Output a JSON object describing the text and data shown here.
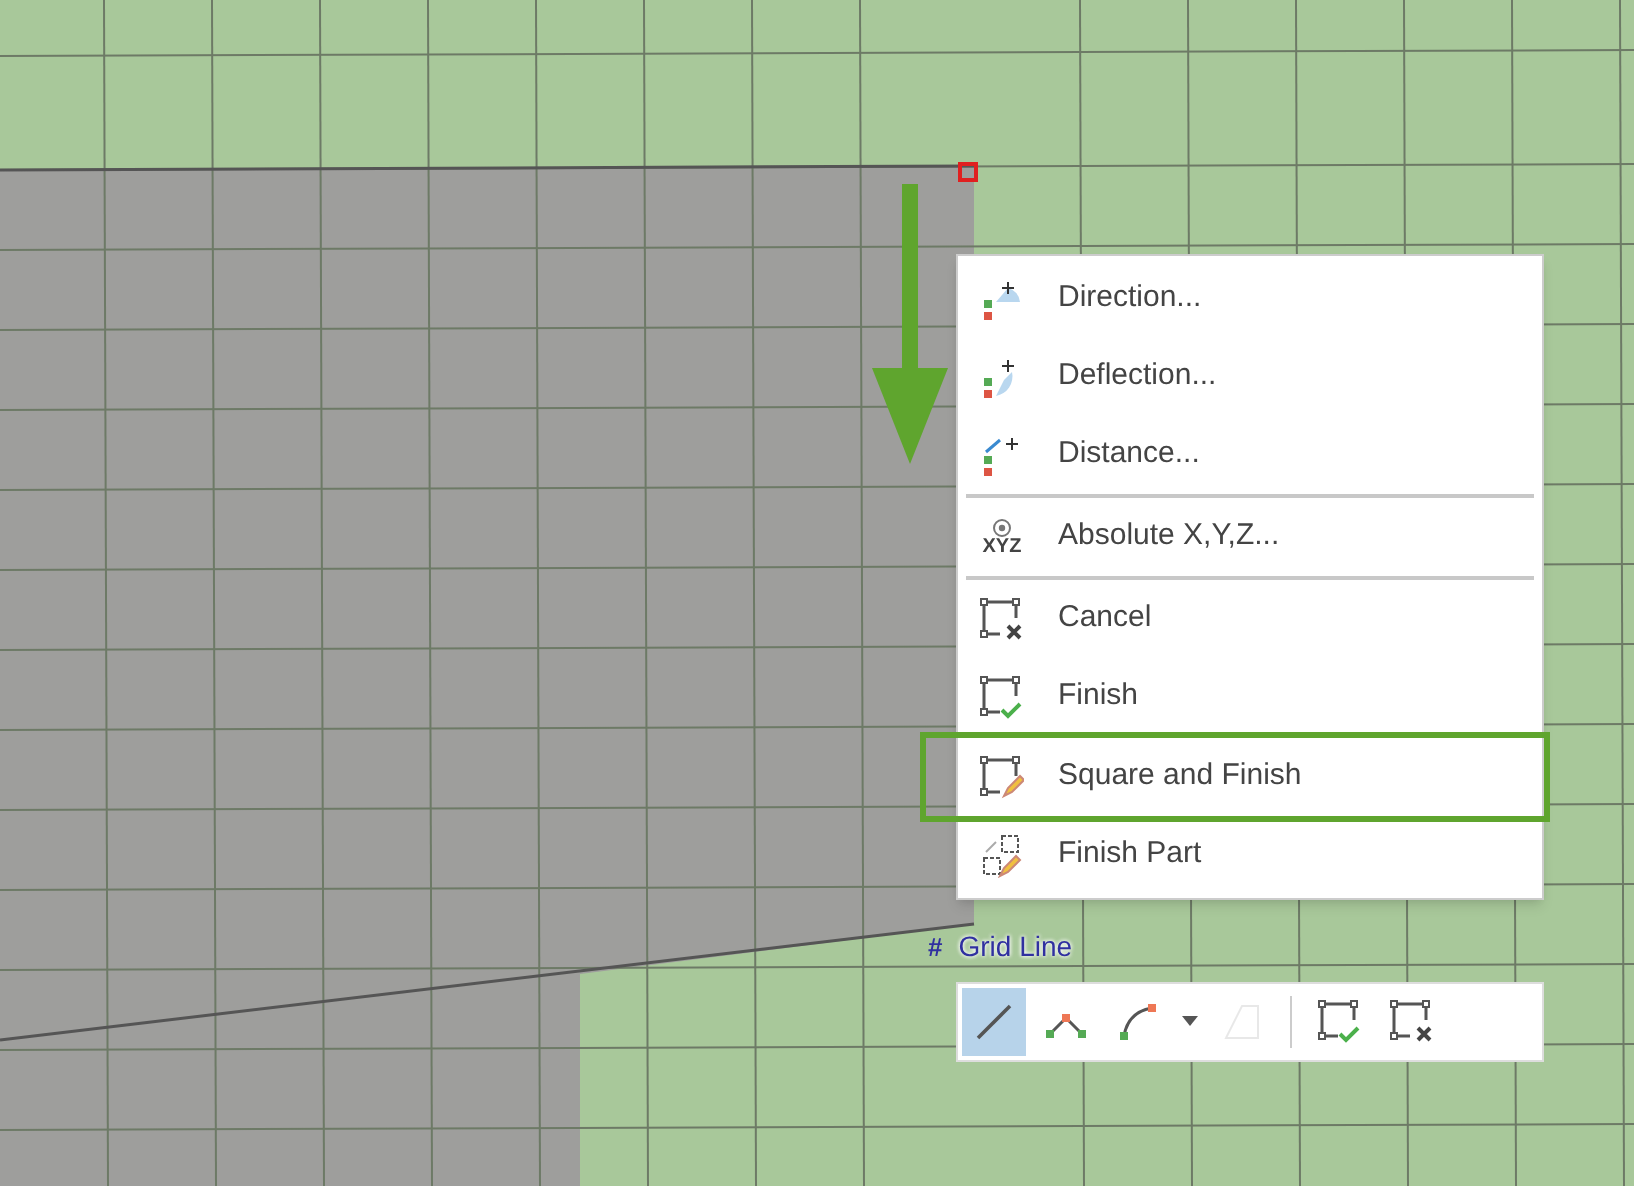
{
  "menu": {
    "groups": [
      {
        "items": [
          {
            "label": "Direction...",
            "kind": "direction",
            "highlighted": false
          },
          {
            "label": "Deflection...",
            "kind": "deflection",
            "highlighted": false
          },
          {
            "label": "Distance...",
            "kind": "distance",
            "highlighted": false
          }
        ]
      },
      {
        "items": [
          {
            "label": "Absolute X,Y,Z...",
            "kind": "xyz",
            "icon_label": "XYZ",
            "highlighted": false
          }
        ]
      },
      {
        "items": [
          {
            "label": "Cancel",
            "kind": "cancel",
            "highlighted": false
          },
          {
            "label": "Finish",
            "kind": "finish",
            "highlighted": false
          },
          {
            "label": "Square and Finish",
            "kind": "square",
            "highlighted": true
          },
          {
            "label": "Finish Part",
            "kind": "part",
            "highlighted": false
          }
        ]
      }
    ]
  },
  "snap_label": {
    "symbol": "#",
    "text": "Grid Line"
  },
  "toolbar": {
    "tools": [
      {
        "kind": "line",
        "selected": true,
        "disabled": false
      },
      {
        "kind": "polyline",
        "selected": false,
        "disabled": false
      },
      {
        "kind": "arc",
        "selected": false,
        "disabled": false
      },
      {
        "kind": "dropdown",
        "selected": false,
        "disabled": false
      },
      {
        "kind": "polygon",
        "selected": false,
        "disabled": true
      },
      {
        "kind": "separator"
      },
      {
        "kind": "finish",
        "selected": false,
        "disabled": false
      },
      {
        "kind": "cancel",
        "selected": false,
        "disabled": false
      }
    ]
  }
}
